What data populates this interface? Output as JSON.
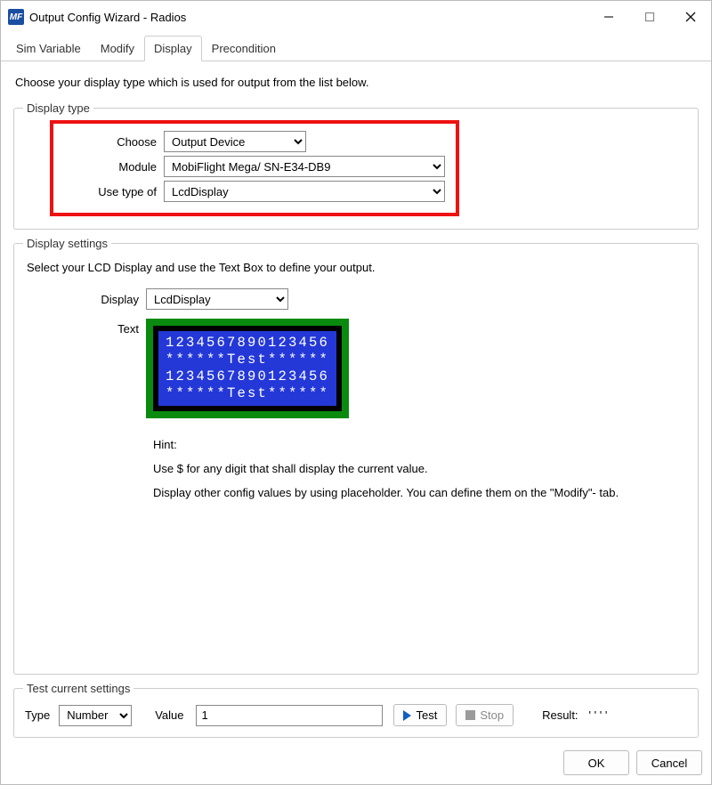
{
  "window": {
    "title": "Output Config Wizard - Radios",
    "icon_text": "MF"
  },
  "tabs": [
    "Sim Variable",
    "Modify",
    "Display",
    "Precondition"
  ],
  "active_tab": "Display",
  "intro": "Choose your display type which is used for output from the list below.",
  "display_type": {
    "legend": "Display type",
    "labels": {
      "choose": "Choose",
      "module": "Module",
      "use_type": "Use type of"
    },
    "choose_value": "Output Device",
    "module_value": "MobiFlight Mega/ SN-E34-DB9",
    "use_type_value": "LcdDisplay"
  },
  "display_settings": {
    "legend": "Display settings",
    "desc": "Select your LCD Display and use the Text Box to define your output.",
    "labels": {
      "display": "Display",
      "text": "Text",
      "hint": "Hint:"
    },
    "display_value": "LcdDisplay",
    "lcd_lines": [
      "1234567890123456",
      "******Test******",
      "1234567890123456",
      "******Test******"
    ],
    "hint_lines": [
      "Use $ for any digit that shall display the current value.",
      "Display other config values by using placeholder. You can define them on the \"Modify\"- tab."
    ]
  },
  "test": {
    "legend": "Test current settings",
    "type_label": "Type",
    "type_value": "Number",
    "value_label": "Value",
    "value_value": "1",
    "test_btn": "Test",
    "stop_btn": "Stop",
    "result_label": "Result:",
    "result_value": "' ' ' '"
  },
  "footer": {
    "ok": "OK",
    "cancel": "Cancel"
  }
}
